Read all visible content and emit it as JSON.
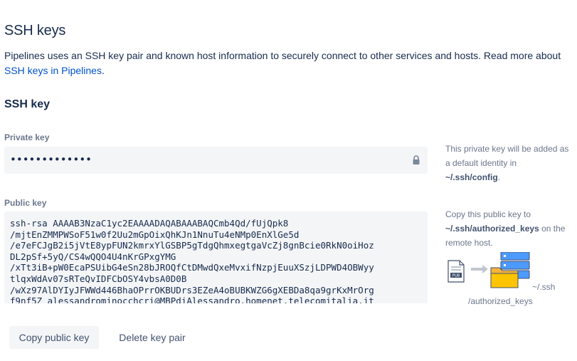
{
  "page": {
    "title": "SSH keys",
    "intro_text": "Pipelines uses an SSH key pair and known host information to securely connect to other services and hosts. Read more about ",
    "intro_link": "SSH keys in Pipelines",
    "intro_end": "."
  },
  "ssh_key": {
    "section_title": "SSH key",
    "private_label": "Private key",
    "private_value": "•••••••••••••",
    "private_help_a": "This private key will be added as a default identity in ",
    "private_help_path": "~/.ssh/config",
    "private_help_b": ".",
    "public_label": "Public key",
    "public_value": "ssh-rsa AAAAB3NzaC1yc2EAAAADAQABAAABAQCmb4Qd/fUjQpk8\n/mjtEnZMMPWSoF51w0f2Uu2mGpOixQhKJn1NnuTu4eNMp0EnXlGe5d\n/e7eFCJgB2i5jVtE8ypFUN2kmrxYlGSBP5gTdgQhmxegtgaVcZj8gnBcie0RkN0oiHoz\nDL2pSf+5yQ/CS4wQQO4U4nKrGPxgYMG\n/xTt3iB+pW0EcaPSUibG4eSn28bJROQfCtDMwdQxeMvxifNzpjEuuXSzjLDPWD4OBWyy\ntlqxWdAv07sRTeQvIDFCbOSY4vbsA0D0B\n/wXz97AlDYIyJFWWd446BhaOPrrOKBUDrs3EZeA4oBUBKWZG6gXEBDa8qa9grKxMrOrg\nf9nf5Z alessandrominocchcri@MBPdiAlessandro.homenet.telecomitalia.it",
    "public_help_a": "Copy this public key to ",
    "public_help_path": "~/.ssh/authorized_keys",
    "public_help_b": " on the remote host.",
    "pub_badge": "PUB",
    "illus_caption_1": "~/.ssh",
    "illus_caption_2": "/authorized_keys"
  },
  "actions": {
    "copy_label": "Copy public key",
    "delete_label": "Delete key pair"
  },
  "colors": {
    "link": "#0052cc",
    "field_bg": "#f4f5f7",
    "folder": "#f6b33a",
    "server": "#4c9aff"
  },
  "icons": [
    "lock-icon",
    "pub-file-icon",
    "arrow-right-icon",
    "server-icon",
    "folder-icon"
  ]
}
